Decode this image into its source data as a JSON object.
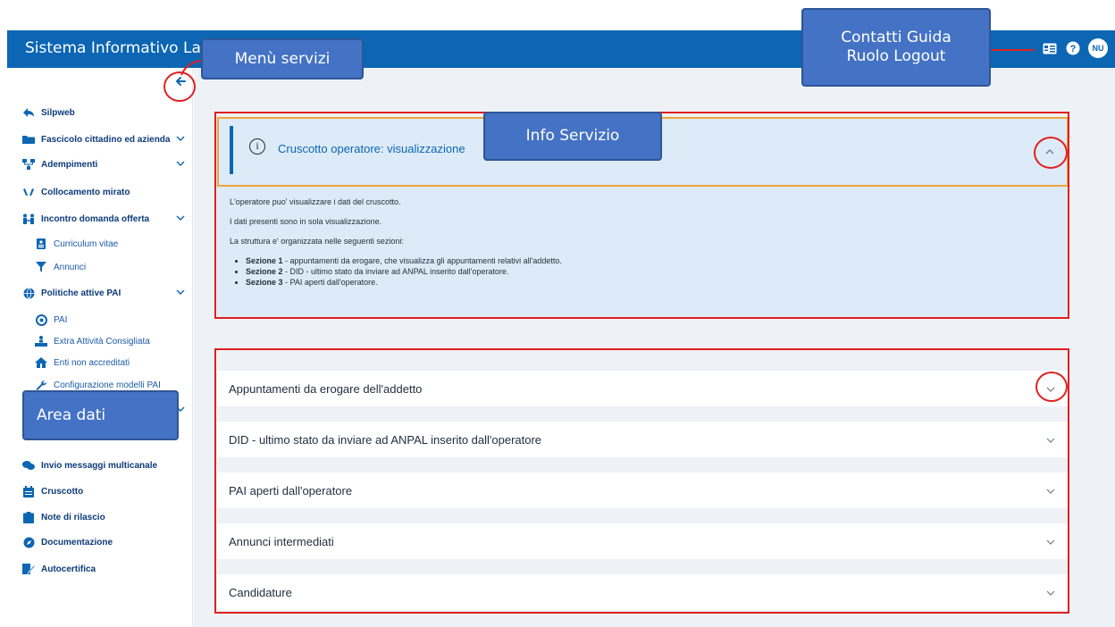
{
  "header": {
    "title": "Sistema Informativo Lavoro",
    "avatar_initials": "NU",
    "icons": [
      "contact-card-icon",
      "help-icon"
    ]
  },
  "sidebar": {
    "items": [
      {
        "label": "Silpweb",
        "icon": "back-share-icon",
        "level": 0,
        "expandable": false
      },
      {
        "label": "Fascicolo cittadino ed azienda",
        "icon": "folder-icon",
        "level": 0,
        "expandable": true
      },
      {
        "label": "Adempimenti",
        "icon": "network-icon",
        "level": 0,
        "expandable": true
      },
      {
        "label": "Collocamento mirato",
        "icon": "hands-icon",
        "level": 0,
        "expandable": false
      },
      {
        "label": "Incontro domanda offerta",
        "icon": "match-icon",
        "level": 0,
        "expandable": true
      },
      {
        "label": "Curriculum vitae",
        "icon": "document-icon",
        "level": 1,
        "expandable": false
      },
      {
        "label": "Annunci",
        "icon": "filter-icon",
        "level": 1,
        "expandable": false
      },
      {
        "label": "Politiche attive PAI",
        "icon": "globe-icon",
        "level": 0,
        "expandable": true
      },
      {
        "label": "PAI",
        "icon": "target-icon",
        "level": 1,
        "expandable": false
      },
      {
        "label": "Extra Attività Consigliata",
        "icon": "person-desk-icon",
        "level": 1,
        "expandable": false
      },
      {
        "label": "Enti non accreditati",
        "icon": "house-icon",
        "level": 1,
        "expandable": false
      },
      {
        "label": "Configurazione modelli PAI",
        "icon": "wrench-icon",
        "level": 1,
        "expandable": false
      },
      {
        "label": "",
        "icon": "",
        "level": 0,
        "expandable": true
      },
      {
        "label": "Invio messaggi multicanale",
        "icon": "chat-icon",
        "level": 0,
        "expandable": false
      },
      {
        "label": "Cruscotto",
        "icon": "calendar-icon",
        "level": 0,
        "expandable": false
      },
      {
        "label": "Note di rilascio",
        "icon": "clipboard-icon",
        "level": 0,
        "expandable": false
      },
      {
        "label": "Documentazione",
        "icon": "compass-icon",
        "level": 0,
        "expandable": false
      },
      {
        "label": "Autocertifica",
        "icon": "signature-icon",
        "level": 0,
        "expandable": false
      }
    ]
  },
  "info": {
    "title": "Cruscotto operatore: visualizzazione",
    "p1": "L'operatore puo' visualizzare i dati del cruscotto.",
    "p2": "I dati presenti sono in sola visualizzazione.",
    "p3": "La struttura e' organizzata nelle seguenti sezioni:",
    "sections": [
      {
        "bold": "Sezione 1",
        "text": " - appuntamenti da erogare, che visualizza gli appuntamenti relativi all'addetto."
      },
      {
        "bold": "Sezione 2",
        "text": " - DID - ultimo stato da inviare ad ANPAL inserito dall'operatore."
      },
      {
        "bold": "Sezione 3",
        "text": " - PAI aperti dall'operatore."
      }
    ]
  },
  "accordion": [
    "Appuntamenti da erogare dell'addetto",
    "DID - ultimo stato da inviare ad ANPAL inserito dall'operatore",
    "PAI aperti dall'operatore",
    "Annunci intermediati",
    "Candidature"
  ],
  "callouts": {
    "menu": "Menù servizi",
    "contacts_l1": "Contatti Guida",
    "contacts_l2": "Ruolo Logout",
    "info": "Info Servizio",
    "area": "Area dati"
  },
  "colors": {
    "brand": "#0c66b3",
    "annotation": "#e01f1f",
    "callout": "#4472c4",
    "info_bg": "#dcebf7"
  }
}
